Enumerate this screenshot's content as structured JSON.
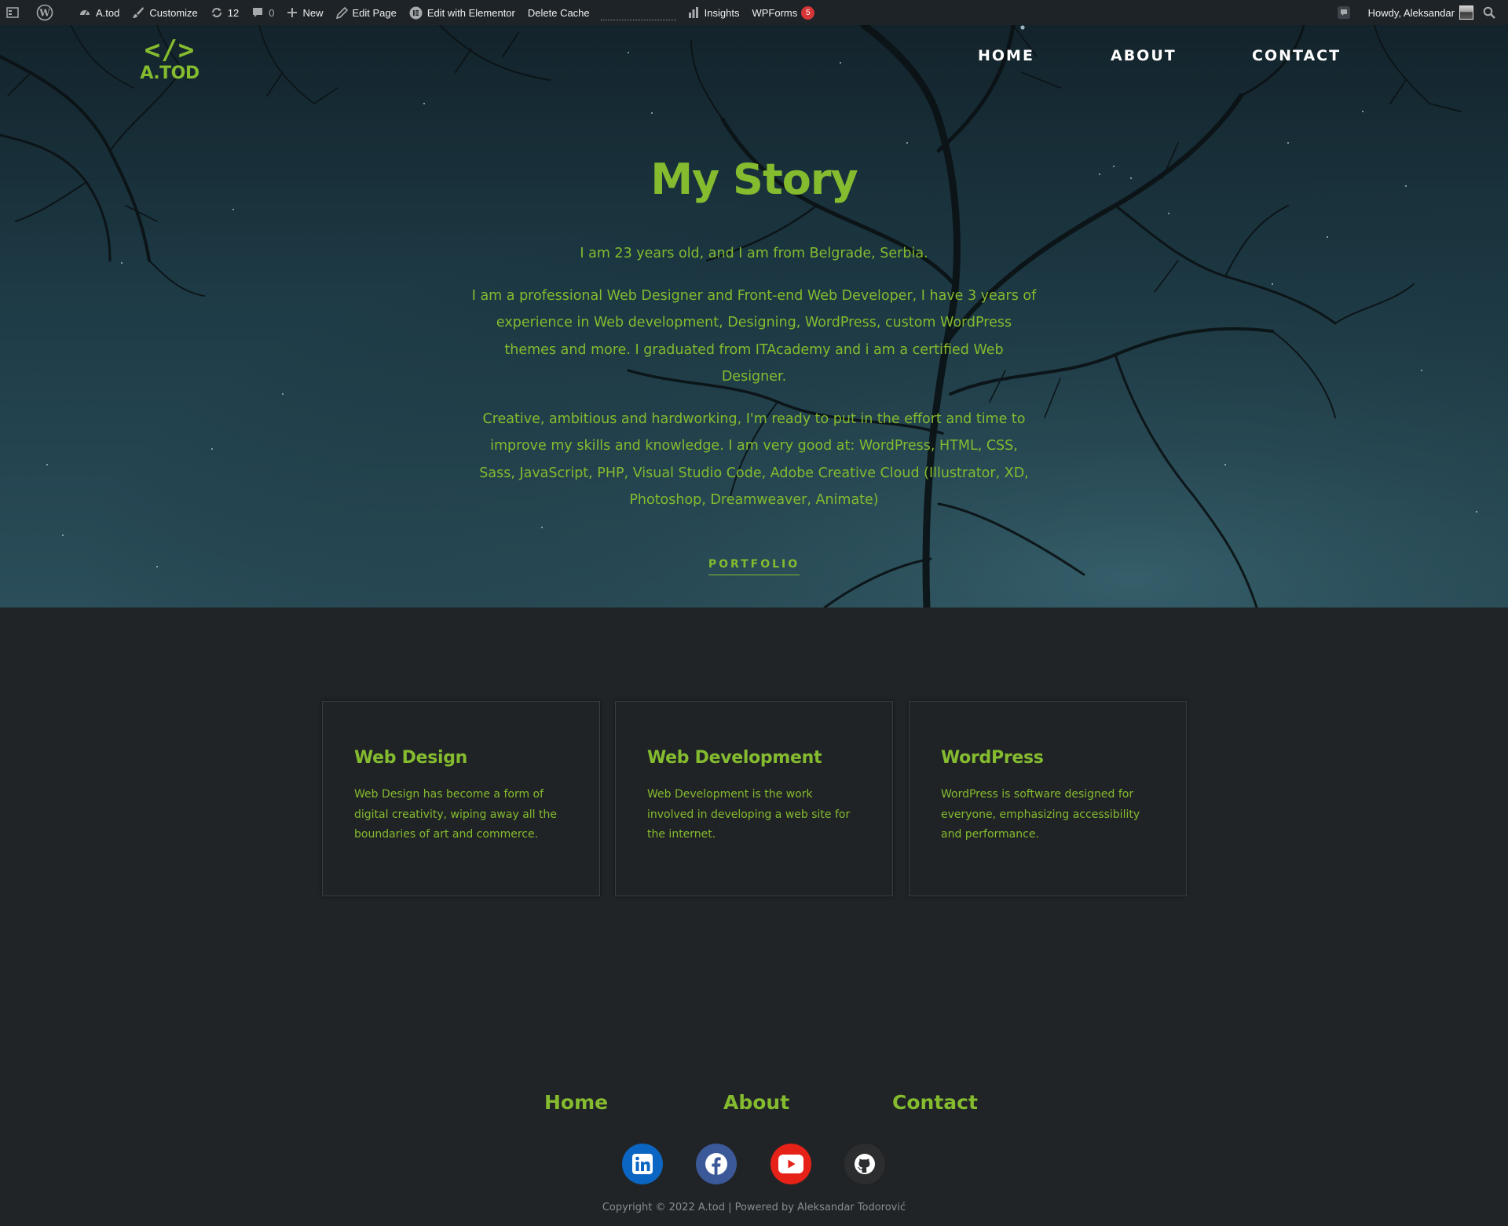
{
  "adminbar": {
    "site_name": "A.tod",
    "customize": "Customize",
    "updates_count": "12",
    "comments_count": "0",
    "new_label": "New",
    "edit_page": "Edit Page",
    "edit_elementor": "Edit with Elementor",
    "delete_cache": "Delete Cache",
    "insights": "Insights",
    "wpforms": "WPForms",
    "wpforms_count": "5",
    "howdy": "Howdy, Aleksandar"
  },
  "logo": {
    "mark": "</>",
    "text": "A.TOD"
  },
  "nav": {
    "home": "HOME",
    "about": "ABOUT",
    "contact": "CONTACT"
  },
  "hero": {
    "title": "My Story",
    "para1": "I am 23 years old, and I am from Belgrade, Serbia.",
    "para2": "I am a professional Web Designer and Front-end Web Developer, I have 3 years of experience in Web development, Designing, WordPress, custom WordPress themes and more. I graduated from ITAcademy and i am a certified Web Designer.",
    "para3": "Creative, ambitious and hardworking, I'm ready to put in the effort and time to improve my skills and knowledge. I am very good at: WordPress, HTML, CSS, Sass, JavaScript, PHP, Visual Studio Code, Adobe Creative Cloud (Illustrator, XD, Photoshop, Dreamweaver, Animate)",
    "button": "PORTFOLIO"
  },
  "services": [
    {
      "title": "Web Design",
      "text": "Web Design has become a form of digital creativity, wiping away all the boundaries of art and commerce."
    },
    {
      "title": "Web Development",
      "text": "Web Development is the work involved in developing a web site for the internet."
    },
    {
      "title": "WordPress",
      "text": "WordPress is software designed for everyone, emphasizing accessibility and performance."
    }
  ],
  "footer": {
    "nav": {
      "home": "Home",
      "about": "About",
      "contact": "Contact"
    },
    "social": [
      {
        "icon": "linkedin-icon",
        "color": "#0a66c2"
      },
      {
        "icon": "facebook-icon",
        "color": "#3b5998"
      },
      {
        "icon": "youtube-icon",
        "color": "#e62117"
      },
      {
        "icon": "github-icon",
        "color": "#2b2d2f"
      }
    ],
    "copyright": "Copyright © 2022 A.tod | Powered by Aleksandar Todorović"
  },
  "colors": {
    "accent": "#84bb2f",
    "page_bg": "#212426",
    "adminbar_bg": "#1d2327"
  }
}
